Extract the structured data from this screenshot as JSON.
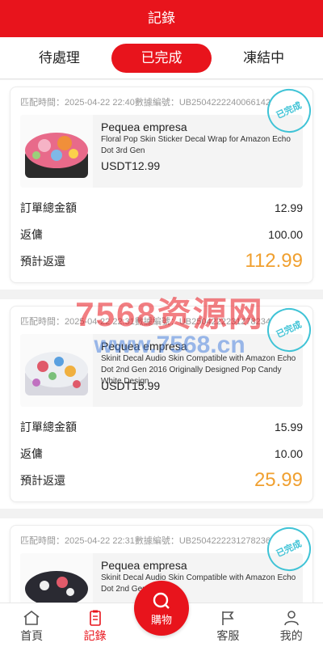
{
  "header": {
    "title": "記錄"
  },
  "tabs": [
    {
      "label": "待處理"
    },
    {
      "label": "已完成"
    },
    {
      "label": "凍結中"
    }
  ],
  "stamp_text": "已完成",
  "orders": [
    {
      "match_time": "匹配時間：2025-04-22 22:40數據編號：UB2504222240066142",
      "shop": "Pequea empresa",
      "title": "Floral Pop Skin Sticker Decal Wrap for Amazon Echo Dot 3rd Gen",
      "price": "USDT12.99",
      "total_label": "訂單總金額",
      "total_value": "12.99",
      "commission_label": "返傭",
      "commission_value": "100.00",
      "expected_label": "預計返還",
      "expected_value": "112.99"
    },
    {
      "match_time": "匹配時間：2025-04-22 22:31數據編號：UB2504222231278234",
      "shop": "Pequea empresa",
      "title": "Skinit Decal Audio Skin Compatible with Amazon Echo Dot 2nd Gen 2016 Originally Designed Pop Candy White Design",
      "price": "USDT15.99",
      "total_label": "訂單總金額",
      "total_value": "15.99",
      "commission_label": "返傭",
      "commission_value": "10.00",
      "expected_label": "預計返還",
      "expected_value": "25.99"
    },
    {
      "match_time": "匹配時間：2025-04-22 22:31數據編號：UB2504222231278236",
      "shop": "Pequea empresa",
      "title": "Skinit Decal Audio Skin Compatible with Amazon Echo Dot 2nd Gen",
      "price": "",
      "total_label": "",
      "total_value": "",
      "commission_label": "",
      "commission_value": "",
      "expected_label": "",
      "expected_value": ""
    }
  ],
  "watermark": {
    "line1": "7568资源网",
    "line2": "www.7568.cn"
  },
  "nav": [
    {
      "label": "首頁",
      "icon": "home-icon"
    },
    {
      "label": "記錄",
      "icon": "clipboard-icon"
    },
    {
      "label": "購物",
      "icon": "search-icon"
    },
    {
      "label": "客服",
      "icon": "flag-icon"
    },
    {
      "label": "我的",
      "icon": "user-icon"
    }
  ],
  "colors": {
    "primary": "#e8141c",
    "amount": "#f0a030",
    "stamp": "#3fc3d6"
  }
}
